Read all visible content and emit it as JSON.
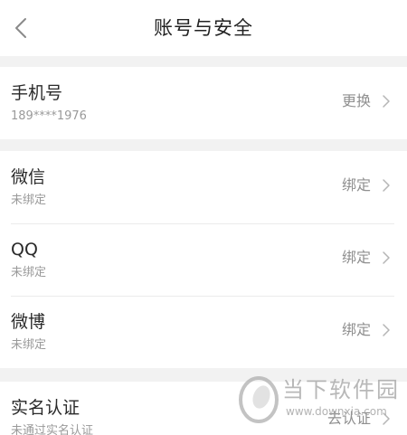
{
  "header": {
    "title": "账号与安全"
  },
  "rows": {
    "phone": {
      "title": "手机号",
      "subtitle": "189****1976",
      "action": "更换"
    },
    "wechat": {
      "title": "微信",
      "subtitle": "未绑定",
      "action": "绑定"
    },
    "qq": {
      "title": "QQ",
      "subtitle": "未绑定",
      "action": "绑定"
    },
    "weibo": {
      "title": "微博",
      "subtitle": "未绑定",
      "action": "绑定"
    },
    "realname": {
      "title": "实名认证",
      "subtitle": "未通过实名认证",
      "action": "去认证"
    }
  },
  "watermark": {
    "text": "当下软件园",
    "url": "www.downxia.com"
  },
  "icons": {
    "back": "chevron-left-icon",
    "row_arrow": "chevron-right-icon"
  },
  "colors": {
    "background": "#f2f2f2",
    "surface": "#ffffff",
    "title": "#222222",
    "secondary": "#9a9a9a"
  }
}
